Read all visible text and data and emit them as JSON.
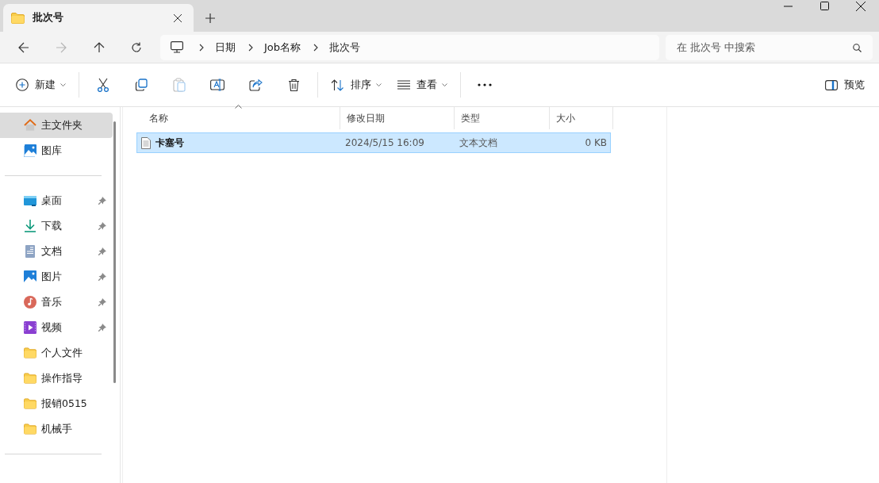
{
  "window": {
    "tab": {
      "title": "批次号",
      "selected": true
    }
  },
  "nav": {
    "back_disabled": false,
    "forward_disabled": true
  },
  "breadcrumb": [
    "日期",
    "Job名称",
    "批次号"
  ],
  "search": {
    "placeholder": "在 批次号 中搜索"
  },
  "toolbar": {
    "new_label": "新建",
    "sort_label": "排序",
    "view_label": "查看",
    "preview_label": "预览"
  },
  "sidebar": {
    "items": [
      {
        "kind": "home",
        "label": "主文件夹",
        "selected": true,
        "pinned": false
      },
      {
        "kind": "gallery",
        "label": "图库",
        "selected": false,
        "pinned": false
      },
      {
        "kind": "divider"
      },
      {
        "kind": "desktop",
        "label": "桌面",
        "selected": false,
        "pinned": true
      },
      {
        "kind": "download",
        "label": "下载",
        "selected": false,
        "pinned": true
      },
      {
        "kind": "document",
        "label": "文档",
        "selected": false,
        "pinned": true
      },
      {
        "kind": "pictures",
        "label": "图片",
        "selected": false,
        "pinned": true
      },
      {
        "kind": "music",
        "label": "音乐",
        "selected": false,
        "pinned": true
      },
      {
        "kind": "video",
        "label": "视频",
        "selected": false,
        "pinned": true
      },
      {
        "kind": "folder",
        "label": "个人文件",
        "selected": false,
        "pinned": false
      },
      {
        "kind": "folder",
        "label": "操作指导",
        "selected": false,
        "pinned": false
      },
      {
        "kind": "folder",
        "label": "报销0515",
        "selected": false,
        "pinned": false
      },
      {
        "kind": "folder",
        "label": "机械手",
        "selected": false,
        "pinned": false
      },
      {
        "kind": "divider"
      }
    ]
  },
  "table": {
    "columns": [
      "名称",
      "修改日期",
      "类型",
      "大小"
    ],
    "rows": [
      {
        "name": "卡塞号",
        "modified": "2024/5/15 16:09",
        "type": "文本文档",
        "size": "0 KB",
        "selected": true
      }
    ]
  }
}
